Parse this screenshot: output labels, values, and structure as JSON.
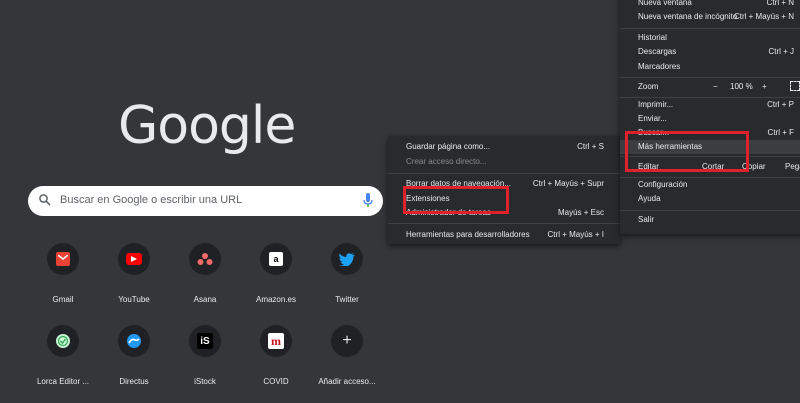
{
  "logo": "Google",
  "search": {
    "placeholder": "Buscar en Google o escribir una URL"
  },
  "shortcuts": [
    {
      "label": "Gmail"
    },
    {
      "label": "YouTube"
    },
    {
      "label": "Asana"
    },
    {
      "label": "Amazon.es",
      "glyph": "a"
    },
    {
      "label": "Twitter"
    },
    {
      "label": "Lorca Editor ..."
    },
    {
      "label": "Directus"
    },
    {
      "label": "iStock",
      "glyph": "iS"
    },
    {
      "label": "COVID",
      "glyph": "m"
    },
    {
      "label": "Añadir acceso...",
      "glyph": "+"
    }
  ],
  "submenu": {
    "items": [
      {
        "label": "Guardar página como...",
        "shortcut": "Ctrl + S"
      },
      {
        "label": "Crear acceso directo...",
        "shortcut": ""
      },
      {
        "label": "Borrar datos de navegación...",
        "shortcut": "Ctrl + Mayús + Supr"
      },
      {
        "label": "Extensiones",
        "shortcut": ""
      },
      {
        "label": "Administrador de tareas",
        "shortcut": "Mayús + Esc"
      },
      {
        "label": "Herramientas para desarrolladores",
        "shortcut": "Ctrl + Mayús + I"
      }
    ]
  },
  "mainmenu": {
    "new_window": {
      "label": "Nueva ventana",
      "shortcut": "Ctrl + N"
    },
    "incognito": {
      "label": "Nueva ventana de incógnito",
      "shortcut": "Ctrl + Mayús + N"
    },
    "history": {
      "label": "Historial"
    },
    "downloads": {
      "label": "Descargas",
      "shortcut": "Ctrl + J"
    },
    "bookmarks": {
      "label": "Marcadores"
    },
    "zoom": {
      "label": "Zoom",
      "minus": "−",
      "value": "100 %",
      "plus": "+"
    },
    "print": {
      "label": "Imprimir...",
      "shortcut": "Ctrl + P"
    },
    "cast": {
      "label": "Enviar..."
    },
    "find": {
      "label": "Buscar...",
      "shortcut": "Ctrl + F"
    },
    "more_tools": {
      "label": "Más herramientas"
    },
    "edit": {
      "label": "Editar",
      "cut": "Cortar",
      "copy": "Copiar",
      "paste": "Pegar"
    },
    "settings": {
      "label": "Configuración"
    },
    "help": {
      "label": "Ayuda"
    },
    "exit": {
      "label": "Salir"
    }
  },
  "colors": {
    "highlight": "#e0202a",
    "menu_bg": "#292a2d",
    "page_bg": "#35363a"
  }
}
